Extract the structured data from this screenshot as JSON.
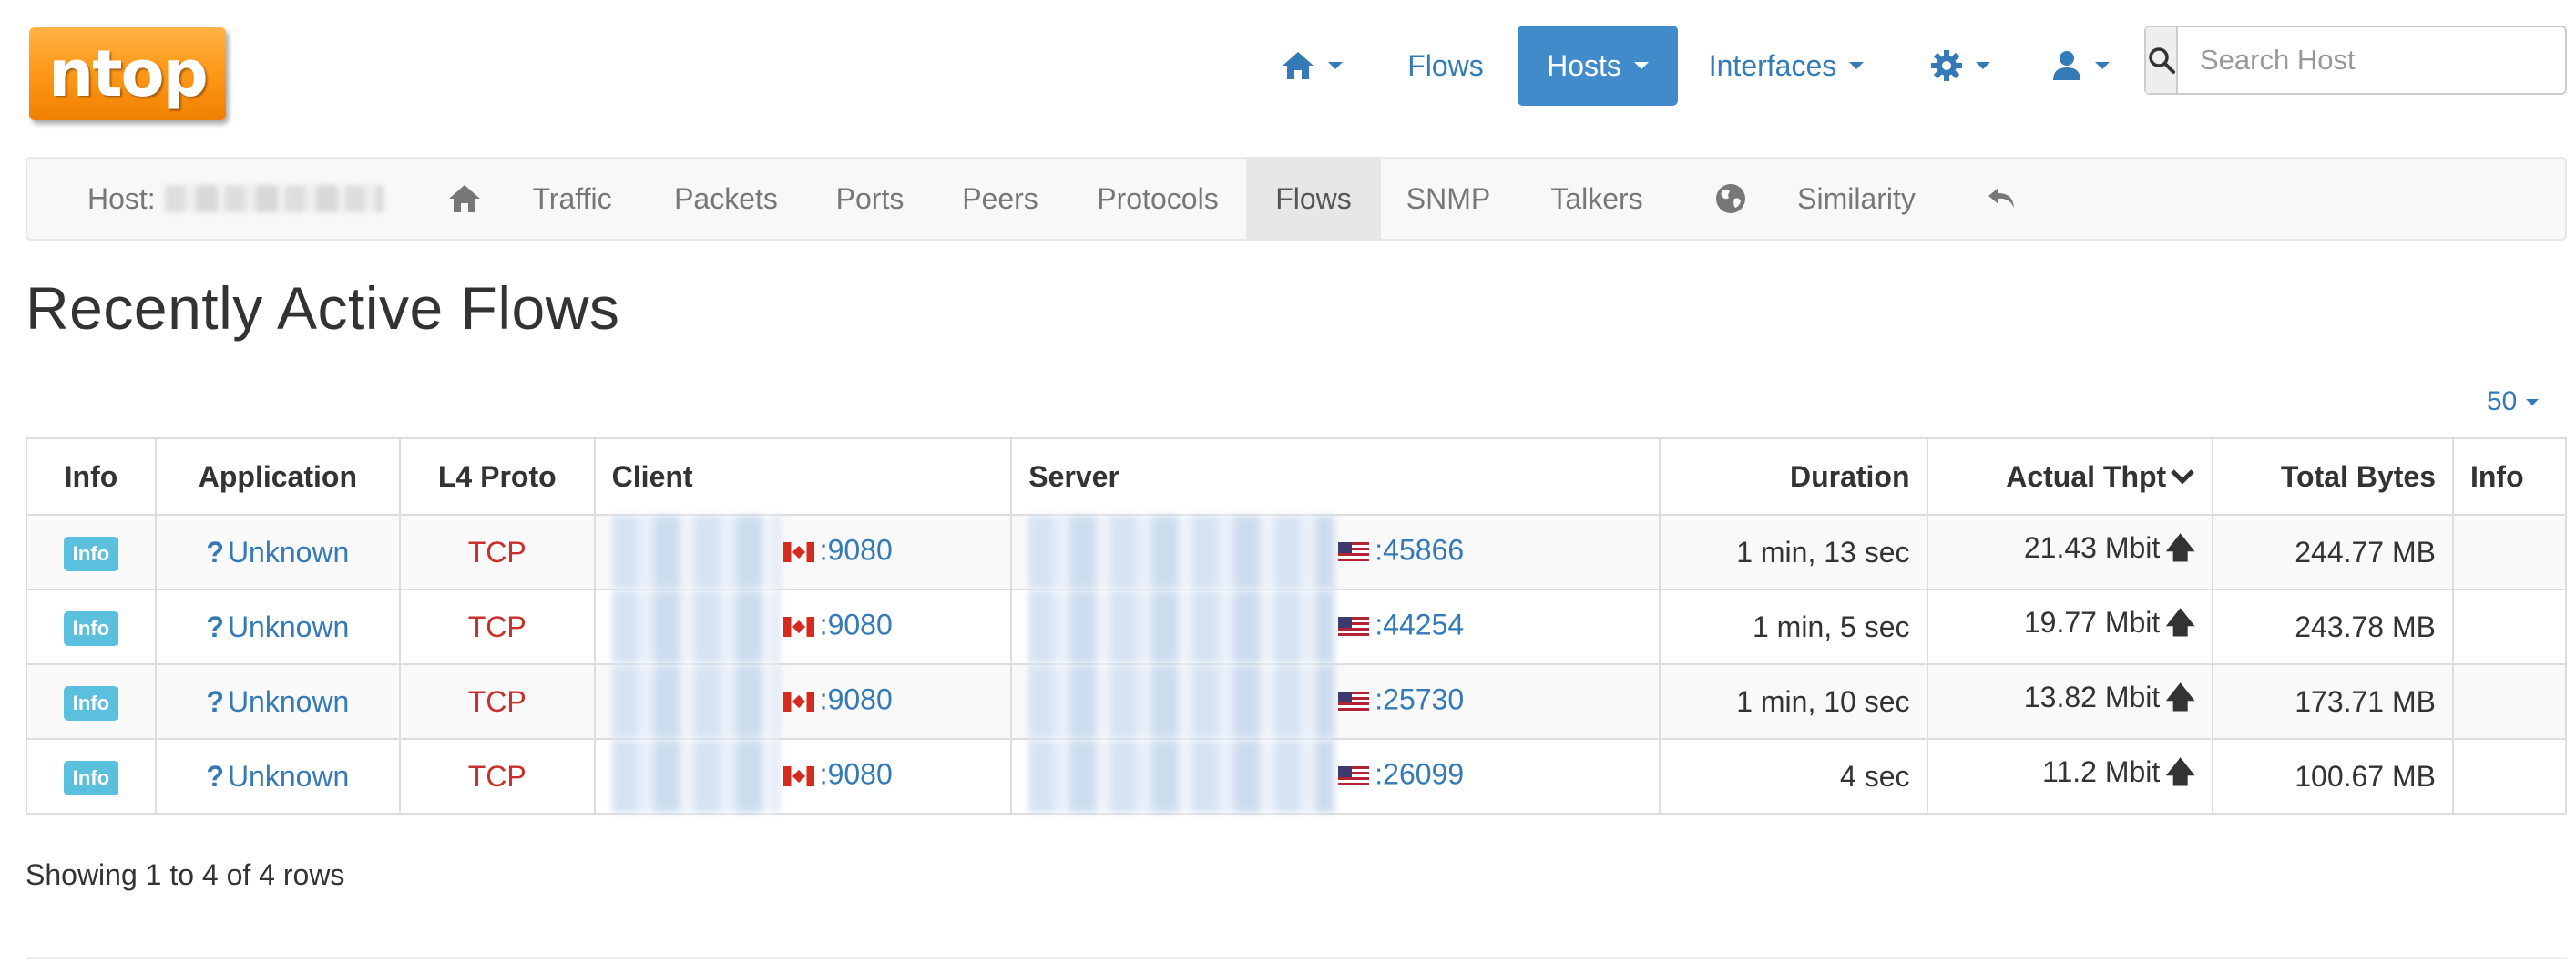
{
  "brand": {
    "logo_text": "ntop"
  },
  "topnav": {
    "flows_label": "Flows",
    "hosts_label": "Hosts",
    "interfaces_label": "Interfaces",
    "search_placeholder": "Search Host",
    "icons": [
      "home-icon",
      "gear-icon",
      "user-icon",
      "search-icon"
    ],
    "active_color": "#428bca"
  },
  "subnav": {
    "host_prefix": "Host:",
    "items": [
      "Traffic",
      "Packets",
      "Ports",
      "Peers",
      "Protocols",
      "Flows",
      "SNMP",
      "Talkers",
      "Similarity"
    ],
    "active": "Flows",
    "icons": [
      "home-icon",
      "globe-icon",
      "back-arrow-icon"
    ]
  },
  "page": {
    "title": "Recently Active Flows",
    "per_page": "50"
  },
  "table": {
    "headers": {
      "info": "Info",
      "application": "Application",
      "l4proto": "L4 Proto",
      "client": "Client",
      "server": "Server",
      "duration": "Duration",
      "thpt": "Actual Thpt",
      "bytes": "Total Bytes",
      "info2": "Info"
    },
    "rows": [
      {
        "info": "Info",
        "application": "Unknown",
        "proto": "TCP",
        "client_port": ":9080",
        "server_port": ":45866",
        "duration": "1 min, 13 sec",
        "thpt": "21.43 Mbit",
        "bytes": "244.77 MB"
      },
      {
        "info": "Info",
        "application": "Unknown",
        "proto": "TCP",
        "client_port": ":9080",
        "server_port": ":44254",
        "duration": "1 min, 5 sec",
        "thpt": "19.77 Mbit",
        "bytes": "243.78 MB"
      },
      {
        "info": "Info",
        "application": "Unknown",
        "proto": "TCP",
        "client_port": ":9080",
        "server_port": ":25730",
        "duration": "1 min, 10 sec",
        "thpt": "13.82 Mbit",
        "bytes": "173.71 MB"
      },
      {
        "info": "Info",
        "application": "Unknown",
        "proto": "TCP",
        "client_port": ":9080",
        "server_port": ":26099",
        "duration": "4 sec",
        "thpt": "11.2 Mbit",
        "bytes": "100.67 MB"
      }
    ],
    "client_flag": "canada-flag-icon",
    "server_flag": "usa-flag-icon"
  },
  "footer": {
    "summary": "Showing 1 to 4 of 4 rows"
  },
  "colors": {
    "link": "#337ab7",
    "info_badge": "#5bc0de",
    "proto": "#c9302c",
    "logo": "#ff9a1a"
  }
}
